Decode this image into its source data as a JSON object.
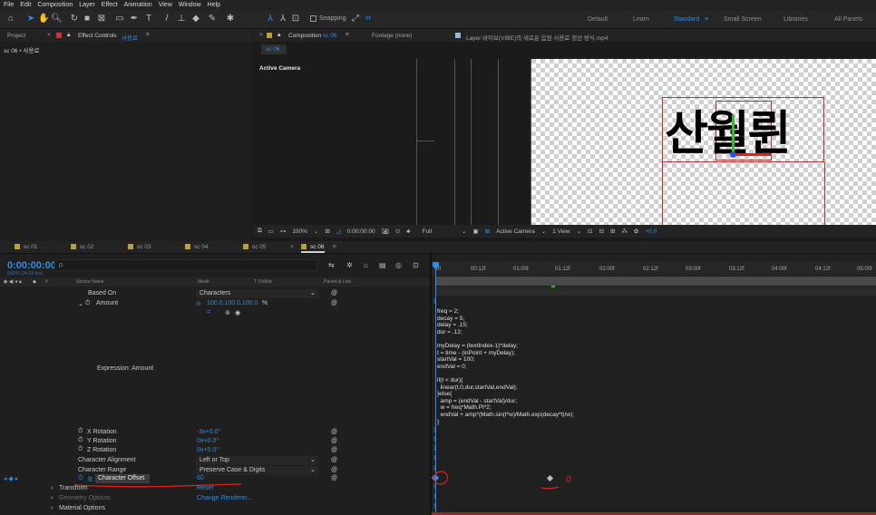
{
  "menu": [
    "File",
    "Edit",
    "Composition",
    "Layer",
    "Effect",
    "Animation",
    "View",
    "Window",
    "Help"
  ],
  "toolbar": {
    "snapping_label": "Snapping",
    "workspaces": [
      "Default",
      "Learn",
      "Standard",
      "Small Screen",
      "Libraries",
      "All Panels"
    ],
    "active_workspace": "Standard"
  },
  "left_panel": {
    "tab_project": "Project",
    "tab_effect_controls": "Effect Controls",
    "effect_controls_layer": "사용료",
    "breadcrumb": "sc 06 • 사용료"
  },
  "comp_panel": {
    "tab_composition": "Composition",
    "composition_name": "sc 06",
    "tab_footage": "Footage (none)",
    "tab_layer": "Layer 바이브(VIBE)의 새로운 음원 사용료 정산 방식.mp4",
    "sub_tab": "sc 06",
    "active_camera_label": "Active Camera",
    "viewer_text": "산월륀"
  },
  "viewer_bar": {
    "zoom": "100%",
    "timecode": "0:00:00:00",
    "resolution": "Full",
    "camera": "Active Camera",
    "views": "1 View",
    "exposure": "+0.0"
  },
  "comp_tabs": [
    "sc 01",
    "sc 02",
    "sc 03",
    "sc 04",
    "sc 05",
    "sc 06"
  ],
  "active_comp_tab": "sc 06",
  "timeline": {
    "current_time": "0:00:00:00",
    "fps_note": "00000 (24.00 fps)",
    "search_placeholder": "ρ.",
    "headers": {
      "source_name": "Source Name",
      "mode": "Mode",
      "trkmat": "T  TrkMat",
      "parent_link": "Parent & Link"
    },
    "ruler": [
      "0f",
      "00:12f",
      "01:00f",
      "01:12f",
      "02:00f",
      "02:12f",
      "03:00f",
      "03:12f",
      "04:00f",
      "04:12f",
      "05:00f"
    ],
    "rows": {
      "based_on_label": "Based On",
      "based_on_value": "Characters",
      "amount_label": "Amount",
      "amount_value": "100.0,100.0,100.0",
      "amount_unit": "%",
      "expression_label": "Expression: Amount",
      "x_rotation_label": "X Rotation",
      "x_rotation_value": "-3x+0.0°",
      "y_rotation_label": "Y Rotation",
      "y_rotation_value": "0x+0.0°",
      "z_rotation_label": "Z Rotation",
      "z_rotation_value": "0x+0.0°",
      "char_alignment_label": "Character Alignment",
      "char_alignment_value": "Left or Top",
      "char_range_label": "Character Range",
      "char_range_value": "Preserve Case & Digits",
      "char_offset_label": "Character Offset",
      "char_offset_value": "60",
      "transform_label": "Transform",
      "transform_value": "Reset",
      "geometry_label": "Geometry Options",
      "geometry_value": "Change Renderer...",
      "material_label": "Material Options"
    },
    "expression_code": "freq = 2;\ndecay = 5;\ndelay = .15;\ndur = .12;\n\nmyDelay = (textIndex-1)*delay;\nt = time - (inPoint + myDelay);\nstartVal = 100;\nendVal = 0;\n\nif(t < dur){\n  linear(t,0,dur,startVal,endVal);\n}else{\n  amp = (endVal - startVal)/dur;\n  w = freq*Math.PI*2;\n  endVal + amp*(Math.sin(t*w)/Math.exp(decay*t)/w);\n}",
    "annotation": "0"
  },
  "colors": {
    "accent": "#2d8ceb",
    "annotation": "#e0201f"
  }
}
